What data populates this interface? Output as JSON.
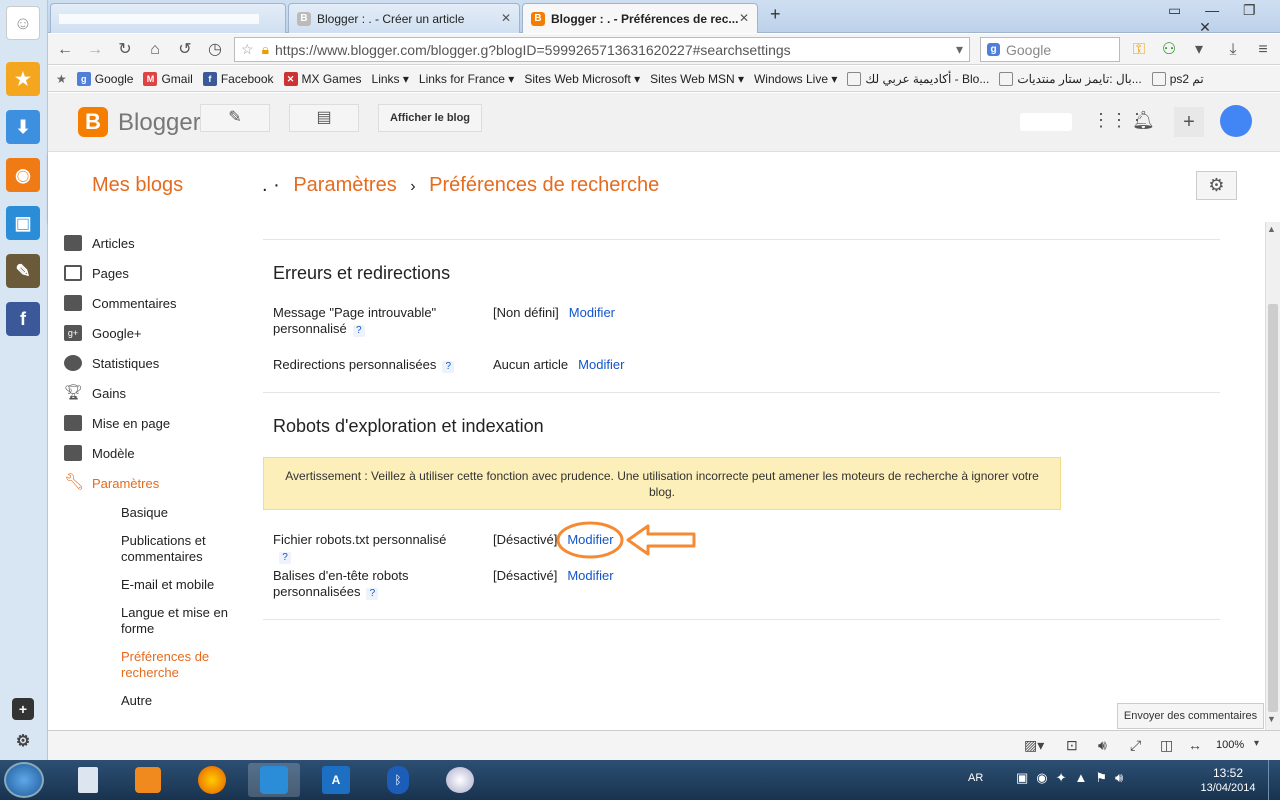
{
  "browser": {
    "tabs": [
      {
        "label": "",
        "active": false
      },
      {
        "label": "Blogger : . - Créer un article",
        "active": false
      },
      {
        "label": "Blogger : . - Préférences de rec...",
        "active": true
      }
    ],
    "new_tab": "+",
    "url": "https://www.blogger.com/blogger.g?blogID=5999265713631620227#searchsettings",
    "search_placeholder": "Google",
    "bookmarks": [
      "Google",
      "Gmail",
      "Facebook",
      "MX Games",
      "Links",
      "Links for France",
      "Sites Web Microsoft",
      "Sites Web MSN",
      "Windows Live",
      "أكاديمية عربي لك - Blo...",
      "بال :تايمز ستار منتديات...",
      "ps2 تم"
    ],
    "zoom": "100%",
    "feedback": "Envoyer des commentaires"
  },
  "blogger": {
    "logo": "Blogger",
    "view_blog": "Afficher le blog",
    "my_blogs": "Mes blogs",
    "crumb_dots": ". ·",
    "crumb_settings": "Paramètres",
    "crumb_sep": "›",
    "crumb_page": "Préférences de recherche"
  },
  "sidebar": {
    "items": [
      "Articles",
      "Pages",
      "Commentaires",
      "Google+",
      "Statistiques",
      "Gains",
      "Mise en page",
      "Modèle",
      "Paramètres"
    ],
    "subitems": [
      "Basique",
      "Publications et commentaires",
      "E-mail et mobile",
      "Langue et mise en forme",
      "Préférences de recherche",
      "Autre"
    ]
  },
  "content": {
    "errors_title": "Erreurs et redirections",
    "row1_label": "Message \"Page introuvable\" personnalisé",
    "row1_value": "[Non défini]",
    "row2_label": "Redirections personnalisées",
    "row2_value": "Aucun article",
    "robots_title": "Robots d'exploration et indexation",
    "warning": "Avertissement : Veillez à utiliser cette fonction avec prudence. Une utilisation incorrecte peut amener les moteurs de recherche à ignorer votre blog.",
    "row3_label": "Fichier robots.txt personnalisé",
    "row3_value": "[Désactivé]",
    "row4_label": "Balises d'en-tête robots personnalisées",
    "row4_value": "[Désactivé]",
    "modify": "Modifier",
    "help": "?"
  },
  "taskbar": {
    "lang": "AR",
    "time": "13:52",
    "date": "13/04/2014"
  },
  "colors": {
    "accent": "#e56b1f",
    "link": "#1155cc",
    "annotation": "#f58a33"
  }
}
